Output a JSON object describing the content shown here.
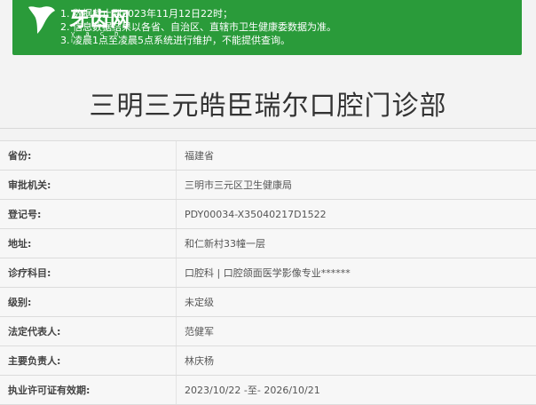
{
  "brand": {
    "logo_text": "牙齿网",
    "logo_sub": "y a c h i"
  },
  "notices": [
    "1. 数据截止到2023年11月12日22时；",
    "2. 信息数据结果以各省、自治区、直辖市卫生健康委数据为准。",
    "3. 凌晨1点至凌晨5点系统进行维护，不能提供查询。"
  ],
  "page_title": "三明三元皓臣瑞尔口腔门诊部",
  "info_rows": [
    {
      "label": "省份:",
      "value": "福建省"
    },
    {
      "label": "审批机关:",
      "value": "三明市三元区卫生健康局"
    },
    {
      "label": "登记号:",
      "value": "PDY00034-X35040217D1522"
    },
    {
      "label": "地址:",
      "value": "和仁新村33幢一层"
    },
    {
      "label": "诊疗科目:",
      "value": "口腔科  |  口腔颌面医学影像专业******"
    },
    {
      "label": "级别:",
      "value": "未定级"
    },
    {
      "label": "法定代表人:",
      "value": "范健军"
    },
    {
      "label": "主要负责人:",
      "value": "林庆杨"
    },
    {
      "label": "执业许可证有效期:",
      "value": "2023/10/22 -至- 2026/10/21"
    }
  ],
  "colors": {
    "banner": "#2a9b3a",
    "background": "#f3f3f3"
  }
}
